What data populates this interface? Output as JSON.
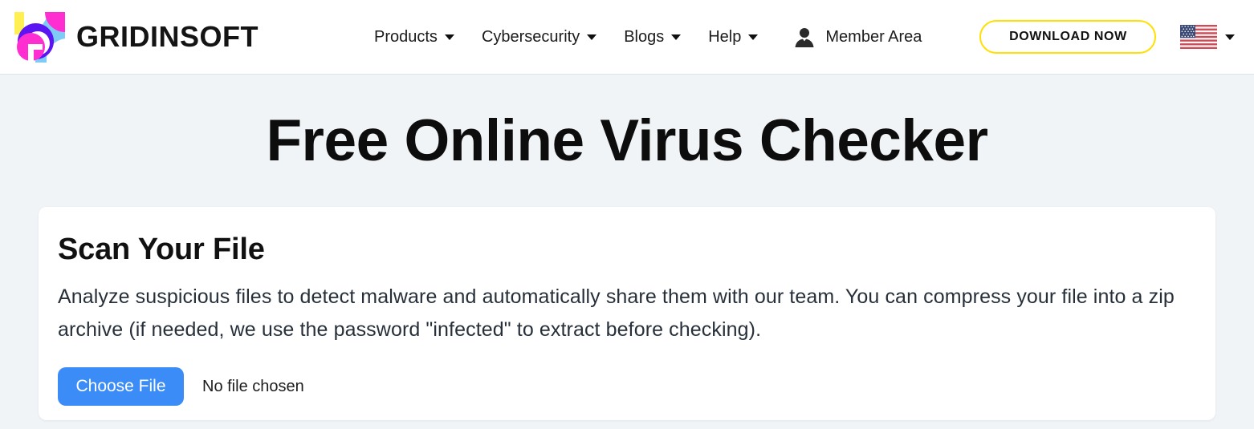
{
  "header": {
    "brand": {
      "name": "GRIDINSOFT",
      "logo_icon": "gridinsoft-logo-icon",
      "colors": {
        "yellow": "#ffef52",
        "magenta": "#ff2ed1",
        "purple": "#5b14f2",
        "light_blue": "#7ecbf7"
      }
    },
    "nav": [
      {
        "label": "Products",
        "has_dropdown": true
      },
      {
        "label": "Cybersecurity",
        "has_dropdown": true
      },
      {
        "label": "Blogs",
        "has_dropdown": true
      },
      {
        "label": "Help",
        "has_dropdown": true
      }
    ],
    "member_area": {
      "label": "Member Area",
      "icon": "user-icon"
    },
    "download_button": {
      "label": "DOWNLOAD NOW",
      "border_color": "#ffe000"
    },
    "language": {
      "flag": "us-flag-icon",
      "has_dropdown": true
    }
  },
  "main": {
    "page_title": "Free Online Virus Checker",
    "card": {
      "title": "Scan Your File",
      "description": "Analyze suspicious files to detect malware and automatically share them with our team. You can compress your file into a zip archive (if needed, we use the password \"infected\" to extract before checking).",
      "file_input": {
        "button_label": "Choose File",
        "status_text": "No file chosen",
        "button_color": "#3b8cf6"
      }
    }
  },
  "theme": {
    "page_background": "#f1f4f7",
    "header_background": "#ffffff",
    "card_background": "#ffffff",
    "text_primary": "#111111"
  }
}
